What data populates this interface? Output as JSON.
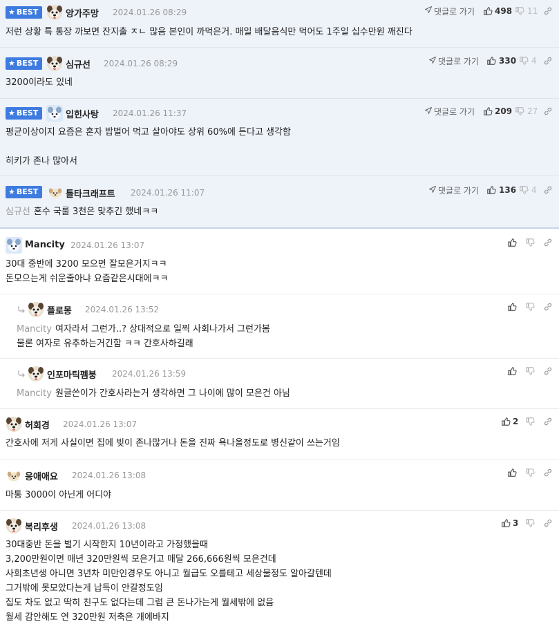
{
  "best_label": "BEST",
  "reply_link_label": "댓글로 가기",
  "best_comments": [
    {
      "nick": "앙가주망",
      "date": "2024.01.26 08:29",
      "likes": "498",
      "dislikes": "11",
      "body": "저런 상황 특 통장 까보면 잔지출 ㅈㄴ 많음 본인이 까먹은거. 매일 배달음식만 먹어도 1주일 십수만원 깨진다",
      "mention": ""
    },
    {
      "nick": "심규선",
      "date": "2024.01.26 08:29",
      "likes": "330",
      "dislikes": "4",
      "body": "3200이라도 있네",
      "mention": ""
    },
    {
      "nick": "입힌사탕",
      "date": "2024.01.26 11:37",
      "likes": "209",
      "dislikes": "27",
      "body": "평균이상이지 요즘은 혼자 밥벌어 먹고 살아야도 상위 60%에 든다고 생각함\n\n히키가 존나 많아서",
      "mention": ""
    },
    {
      "nick": "틀타크래프트",
      "date": "2024.01.26 11:07",
      "likes": "136",
      "dislikes": "4",
      "body": "혼수 국룰 3천은 맞추긴 했네ㅋㅋ",
      "mention": "심규선"
    }
  ],
  "comments": [
    {
      "nick": "Mancity",
      "date": "2024.01.26 13:07",
      "likes": "",
      "body": "30대 중반에 3200 모으면 잘모은거지ㅋㅋ\n돈모으는게 쉬운줄아냐 요즘같은시대에ㅋㅋ",
      "mention": ""
    },
    {
      "nick": "플로몽",
      "date": "2024.01.26 13:52",
      "likes": "",
      "body": "여자라서 그런가..? 상대적으로 일찍 사회나가서 그런가봄\n물론 여자로 유추하는거긴함 ㅋㅋ 간호사하길래",
      "mention": "Mancity"
    },
    {
      "nick": "인포마틱펨붕",
      "date": "2024.01.26 13:59",
      "likes": "",
      "body": "원글쓴이가 간호사라는거 생각하면 그 나이에 많이 모은건 아님",
      "mention": "Mancity"
    },
    {
      "nick": "허회경",
      "date": "2024.01.26 13:07",
      "likes": "2",
      "body": "간호사에 저게 사실이면 집에 빚이 존나많거나 돈을 진짜 욕나올정도로 병신같이 쓰는거임",
      "mention": ""
    },
    {
      "nick": "응애애요",
      "date": "2024.01.26 13:08",
      "likes": "",
      "body": "마통 3000이 아닌게 어디야",
      "mention": ""
    },
    {
      "nick": "복리후생",
      "date": "2024.01.26 13:08",
      "likes": "3",
      "body": "30대중반 돈을 벌기 시작한지 10년이라고 가정했을때\n3,200만원이면 매년 320만원씩 모은거고 매달 266,666원씩 모은건데\n사회초년생 아니면 3년차 미만인경우도 아니고 월급도 오를테고 세상물정도 알아갈텐데\n그거밖에 못모았다는게 납득이 안갈정도임\n집도 차도 없고 딱히 친구도 없다는데 그럼 큰 돈나가는게 월세밖에 없음\n월세 감안해도 연 320만원 저축은 개에바지",
      "mention": ""
    }
  ],
  "colors": {
    "accent": "#3d7be0",
    "best_bg": "#eef2f9",
    "muted": "#999999"
  }
}
